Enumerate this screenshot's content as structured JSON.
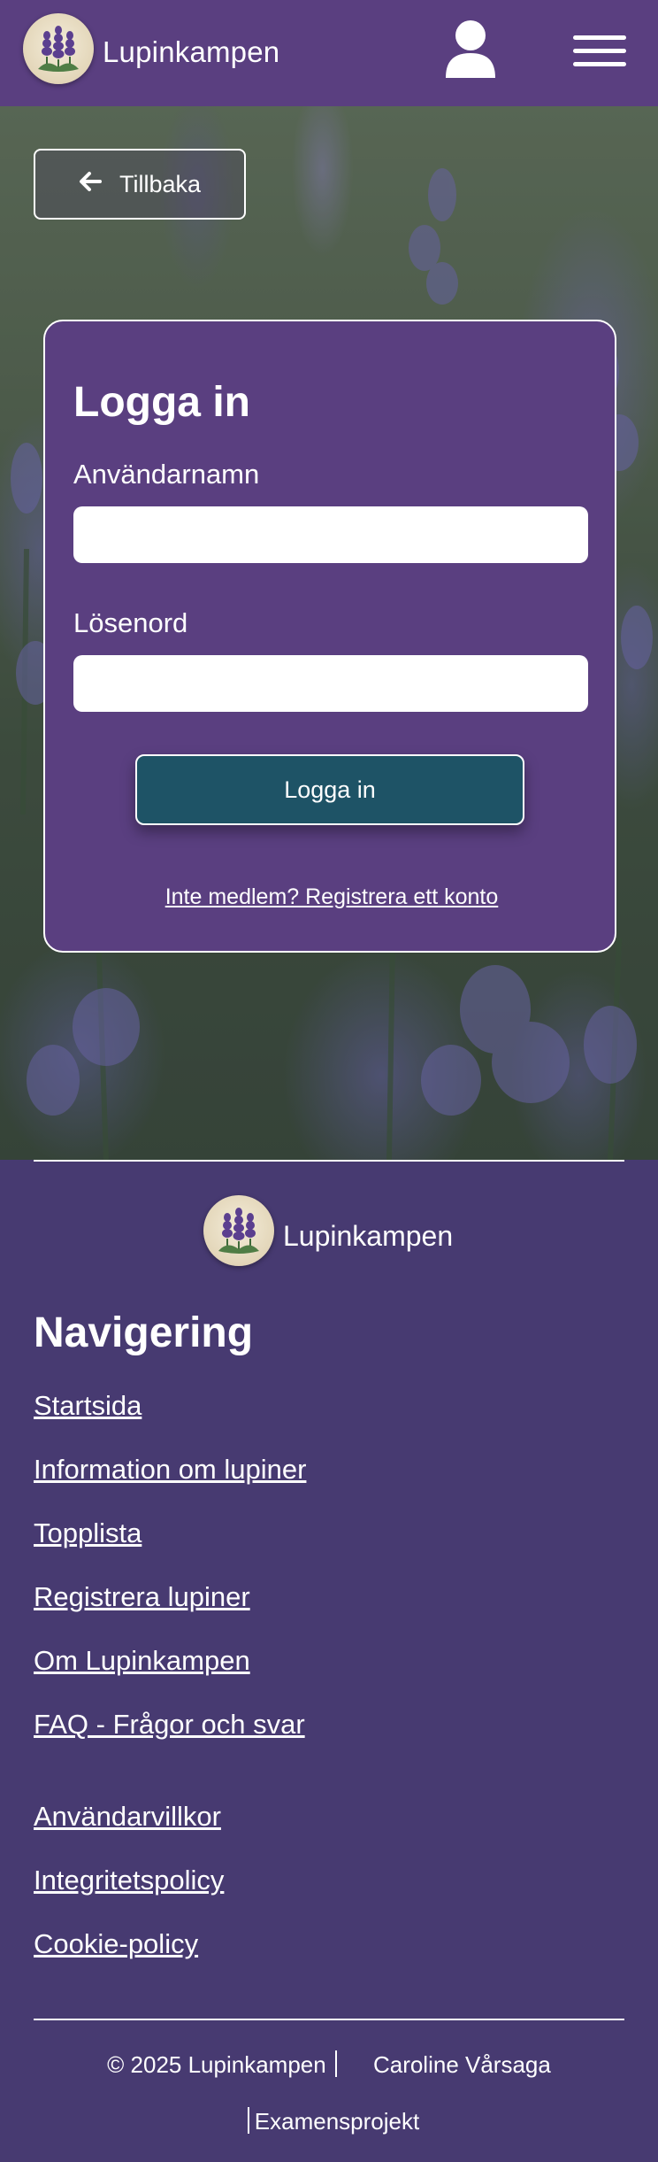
{
  "header": {
    "brand_name": "Lupinkampen",
    "icons": {
      "logo": "lupin-logo-icon",
      "user": "user-icon",
      "menu": "hamburger-menu-icon"
    }
  },
  "hero": {
    "back_button_label": "Tillbaka",
    "back_icon": "arrow-left-icon"
  },
  "login": {
    "title": "Logga in",
    "username_label": "Användarnamn",
    "username_value": "",
    "password_label": "Lösenord",
    "password_value": "",
    "submit_label": "Logga in",
    "register_link": "Inte medlem? Registrera ett konto"
  },
  "footer": {
    "brand_name": "Lupinkampen",
    "nav_heading": "Navigering",
    "nav_links": [
      "Startsida",
      "Information om lupiner",
      "Topplista",
      "Registrera lupiner",
      "Om Lupinkampen",
      "FAQ - Frågor och svar"
    ],
    "legal_links": [
      "Användarvillkor",
      "Integritetspolicy",
      "Cookie-policy"
    ],
    "copyright": "© 2025 Lupinkampen",
    "author": "Caroline Vårsaga",
    "project": "Examensprojekt"
  },
  "colors": {
    "header_bg": "#5a3f80",
    "card_bg": "#5a3f80",
    "footer_bg": "#473a71",
    "button_bg": "#1e5366",
    "text": "#ffffff"
  }
}
